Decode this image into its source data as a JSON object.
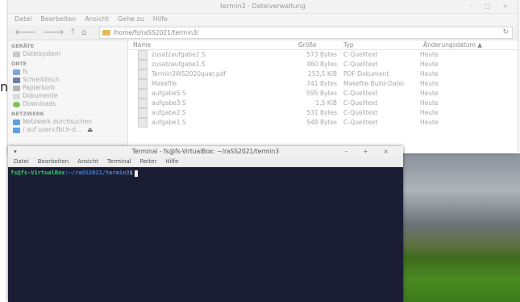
{
  "filemanager": {
    "title": "termin3 - Dateiverwaltung",
    "menu": [
      "Datei",
      "Bearbeiten",
      "Ansicht",
      "Gehe zu",
      "Hilfe"
    ],
    "nav": {
      "back": "🡐",
      "forward": "🡒",
      "up": "🡑",
      "home": "⌂"
    },
    "path": "/home/fs/raSS2021/termin3/",
    "sidebar": {
      "devices_header": "GERÄTE",
      "devices": [
        {
          "label": "Dateisystem",
          "icon": "drive-icon"
        }
      ],
      "places_header": "ORTE",
      "places": [
        {
          "label": "fs",
          "icon": "home-icon"
        },
        {
          "label": "Schreibtisch",
          "icon": "desktop-icon"
        },
        {
          "label": "Papierkorb",
          "icon": "trash-icon"
        },
        {
          "label": "Dokumente",
          "icon": "documents-icon"
        },
        {
          "label": "Downloads",
          "icon": "download-icon"
        }
      ],
      "network_header": "NETZWERK",
      "network": [
        {
          "label": "Netzwerk durchsuchen",
          "icon": "network-icon"
        },
        {
          "label": "/ auf userv.fbi.h-d...",
          "icon": "network-icon"
        }
      ],
      "eject": "⏏"
    },
    "columns": {
      "name": "Name",
      "size": "Größe",
      "type": "Typ",
      "date": "Änderungsdatum ▲"
    },
    "files": [
      {
        "name": "zusatzaufgabe2.S",
        "size": "573 Bytes",
        "type": "C-Quelltext",
        "date": "Heute"
      },
      {
        "name": "zusatzaufgabe1.S",
        "size": "460 Bytes",
        "type": "C-Quelltext",
        "date": "Heute"
      },
      {
        "name": "Termin3WS2020quer.pdf",
        "size": "253,5 KiB",
        "type": "PDF-Dokument",
        "date": "Heute"
      },
      {
        "name": "Makefile",
        "size": "741 Bytes",
        "type": "Makefile Build-Datei",
        "date": "Heute"
      },
      {
        "name": "aufgabe5.S",
        "size": "595 Bytes",
        "type": "C-Quelltext",
        "date": "Heute"
      },
      {
        "name": "aufgabe3.S",
        "size": "1,5 KiB",
        "type": "C-Quelltext",
        "date": "Heute"
      },
      {
        "name": "aufgabe2.S",
        "size": "531 Bytes",
        "type": "C-Quelltext",
        "date": "Heute"
      },
      {
        "name": "aufgabe1.S",
        "size": "548 Bytes",
        "type": "C-Quelltext",
        "date": "Heute"
      }
    ]
  },
  "terminal": {
    "title": "Terminal - fs@fs-VirtualBox: ~/raSS2021/termin3",
    "menu": [
      "Datei",
      "Bearbeiten",
      "Ansicht",
      "Terminal",
      "Reiter",
      "Hilfe"
    ],
    "prompt_user": "fs@fs-VirtualBox",
    "prompt_path": ":~/raSS2021/termin3",
    "prompt_symbol": "$ ",
    "controls": "– + ×"
  },
  "stray_char": "n"
}
